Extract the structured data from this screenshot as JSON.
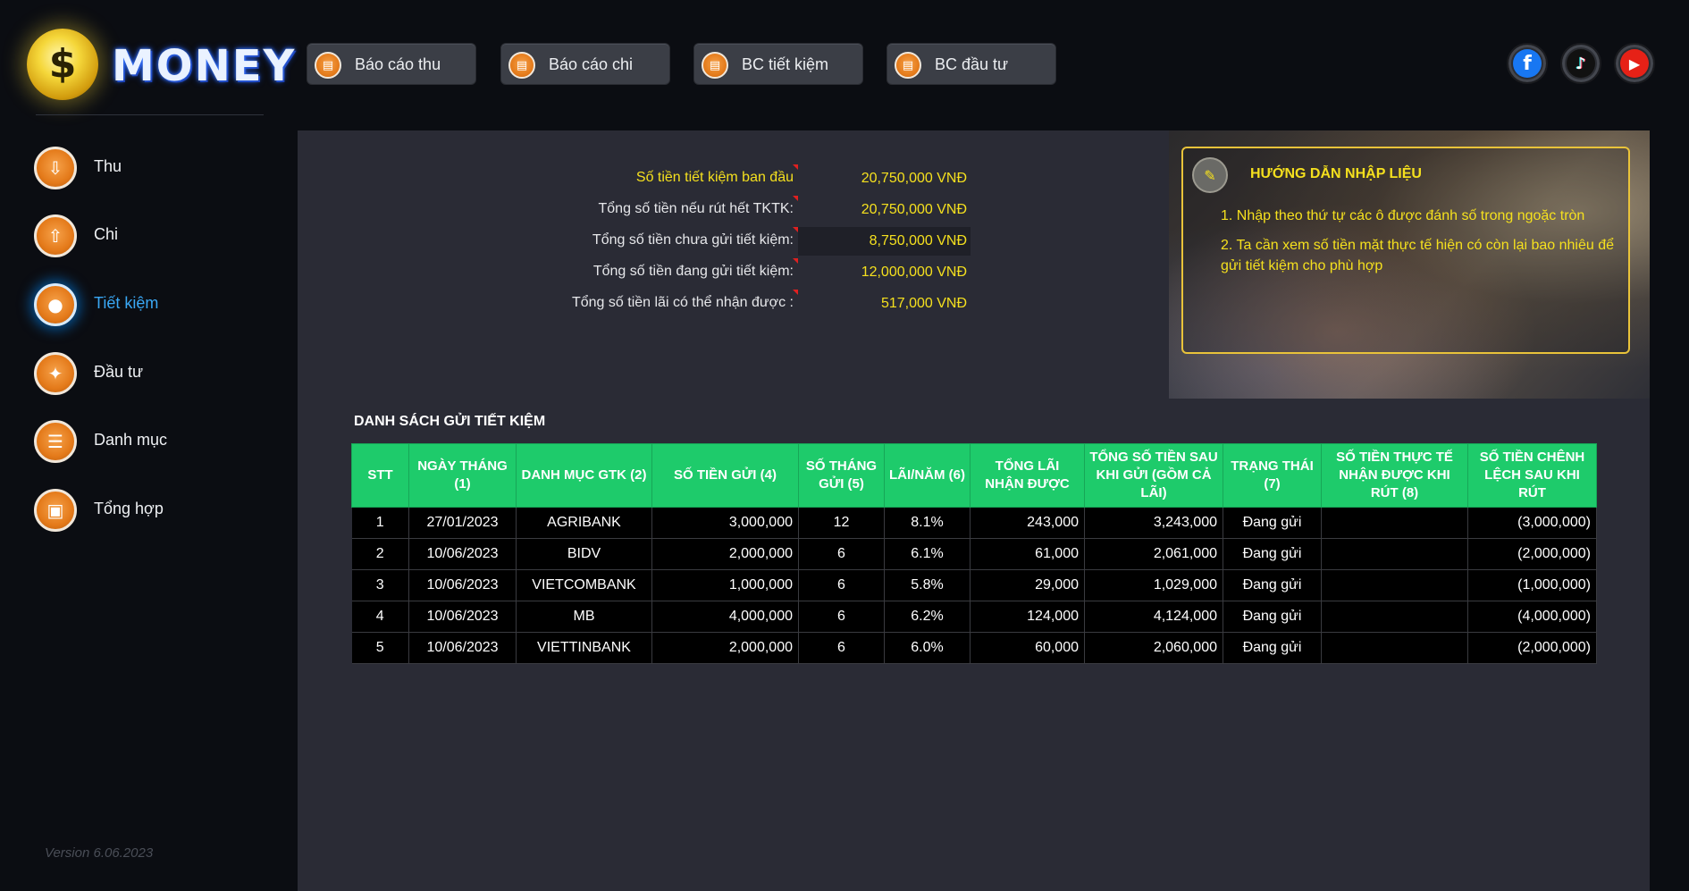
{
  "app": {
    "logo_text": "MONEY",
    "logo_symbol": "$",
    "version": "Version 6.06.2023"
  },
  "sidebar": {
    "items": [
      {
        "label": "Thu",
        "icon": "income-icon",
        "active": false
      },
      {
        "label": "Chi",
        "icon": "expense-icon",
        "active": false
      },
      {
        "label": "Tiết kiệm",
        "icon": "piggy-bank-icon",
        "active": true
      },
      {
        "label": "Đầu tư",
        "icon": "investment-icon",
        "active": false
      },
      {
        "label": "Danh mục",
        "icon": "category-icon",
        "active": false
      },
      {
        "label": "Tổng hợp",
        "icon": "summary-icon",
        "active": false
      }
    ]
  },
  "toolbar": {
    "buttons": [
      {
        "label": "Báo cáo thu",
        "icon": "report-icon"
      },
      {
        "label": "Báo cáo chi",
        "icon": "report-icon"
      },
      {
        "label": "BC tiết kiệm",
        "icon": "report-icon"
      },
      {
        "label": "BC đầu tư",
        "icon": "report-icon"
      }
    ]
  },
  "social": [
    {
      "name": "facebook",
      "icon": "facebook-icon",
      "glyph": "f",
      "color": "#1877f2"
    },
    {
      "name": "tiktok",
      "icon": "tiktok-icon",
      "glyph": "♪",
      "color": "#111111"
    },
    {
      "name": "youtube",
      "icon": "youtube-icon",
      "glyph": "▶",
      "color": "#e62117"
    }
  ],
  "summary": {
    "rows": [
      {
        "label": "Số tiền tiết kiệm ban đầu",
        "value": "20,750,000 VNĐ",
        "highlight": true,
        "boxed": false
      },
      {
        "label": "Tổng số tiền nếu rút hết TKTK:",
        "value": "20,750,000 VNĐ",
        "highlight": false,
        "boxed": false
      },
      {
        "label": "Tổng số tiền chưa gửi tiết kiệm:",
        "value": "8,750,000 VNĐ",
        "highlight": false,
        "boxed": true
      },
      {
        "label": "Tổng số tiền đang gửi tiết kiệm:",
        "value": "12,000,000 VNĐ",
        "highlight": false,
        "boxed": false
      },
      {
        "label": "Tổng số tiền lãi có thể nhận được :",
        "value": "517,000 VNĐ",
        "highlight": false,
        "boxed": false
      }
    ]
  },
  "guide": {
    "title": "HƯỚNG DẪN NHẬP LIỆU",
    "line1": "1. Nhập theo thứ tự các ô được đánh số trong ngoặc tròn",
    "line2": "2. Ta cần xem số tiền mặt thực tế hiện có còn lại bao nhiêu để gửi tiết kiệm cho phù hợp"
  },
  "table": {
    "title": "DANH SÁCH GỬI TIẾT KIỆM",
    "headers": [
      "STT",
      "NGÀY THÁNG (1)",
      "DANH MỤC GTK (2)",
      "SỐ TIỀN GỬI (4)",
      "SỐ THÁNG GỬI (5)",
      "LÃI/NĂM (6)",
      "TỔNG LÃI NHẬN ĐƯỢC",
      "TỔNG SỐ TIỀN SAU KHI GỬI (GỒM CẢ LÃI)",
      "TRẠNG THÁI (7)",
      "SỐ TIỀN THỰC TẾ NHẬN ĐƯỢC KHI RÚT (8)",
      "SỐ TIỀN CHÊNH LỆCH SAU KHI RÚT"
    ],
    "rows": [
      [
        "1",
        "27/01/2023",
        "AGRIBANK",
        "3,000,000",
        "12",
        "8.1%",
        "243,000",
        "3,243,000",
        "Đang gửi",
        "",
        "(3,000,000)"
      ],
      [
        "2",
        "10/06/2023",
        "BIDV",
        "2,000,000",
        "6",
        "6.1%",
        "61,000",
        "2,061,000",
        "Đang gửi",
        "",
        "(2,000,000)"
      ],
      [
        "3",
        "10/06/2023",
        "VIETCOMBANK",
        "1,000,000",
        "6",
        "5.8%",
        "29,000",
        "1,029,000",
        "Đang gửi",
        "",
        "(1,000,000)"
      ],
      [
        "4",
        "10/06/2023",
        "MB",
        "4,000,000",
        "6",
        "6.2%",
        "124,000",
        "4,124,000",
        "Đang gửi",
        "",
        "(4,000,000)"
      ],
      [
        "5",
        "10/06/2023",
        "VIETTINBANK",
        "2,000,000",
        "6",
        "6.0%",
        "60,000",
        "2,060,000",
        "Đang gửi",
        "",
        "(2,000,000)"
      ]
    ]
  },
  "colors": {
    "accent_yellow": "#f5e01e",
    "table_header_green": "#1ecb6b",
    "active_blue": "#3aa8f5",
    "icon_orange": "#e47a1a"
  }
}
